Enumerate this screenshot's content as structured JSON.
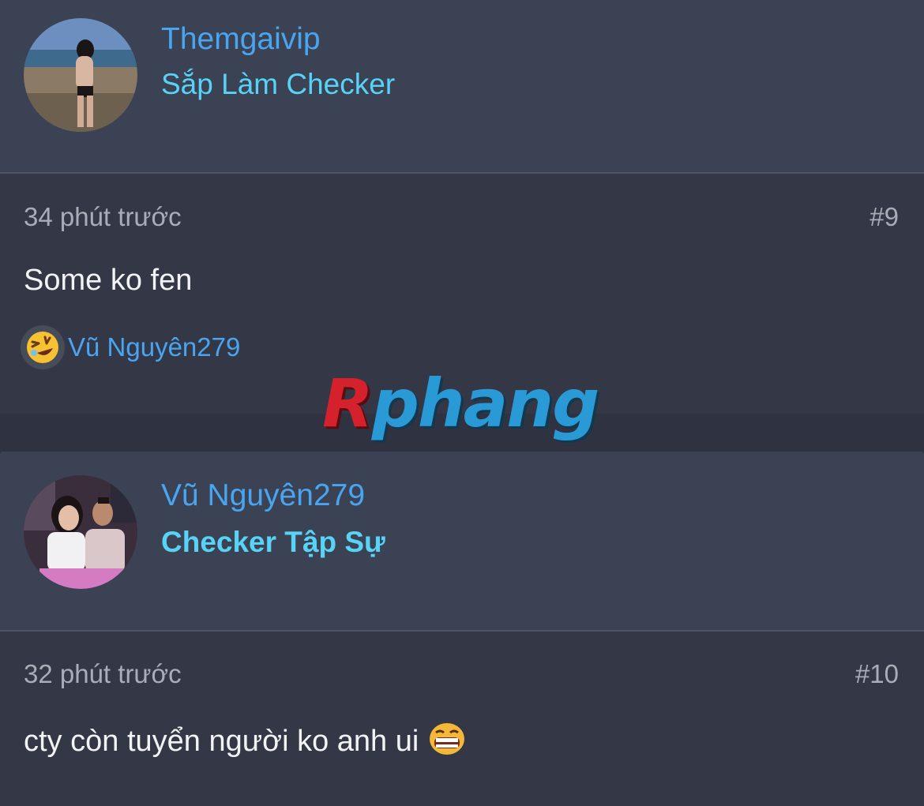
{
  "posts": [
    {
      "author": "Themgaivip",
      "rank": "Sắp Làm Checker",
      "time": "34 phút trước",
      "number": "#9",
      "message": "Some ko fen",
      "reaction": {
        "icon": "rofl-emoji-icon",
        "user": "Vũ Nguyên279"
      }
    },
    {
      "author": "Vũ Nguyên279",
      "rank": "Checker Tập Sự",
      "time": "32 phút trước",
      "number": "#10",
      "message": "cty còn tuyển người ko anh ui"
    }
  ],
  "watermark": {
    "part1": "R",
    "part2": "phang"
  },
  "colors": {
    "username": "#4aa5f0",
    "rank": "#58d3f5",
    "header_bg": "#3b4254",
    "body_bg": "#343846",
    "page_bg": "#2f3341"
  }
}
